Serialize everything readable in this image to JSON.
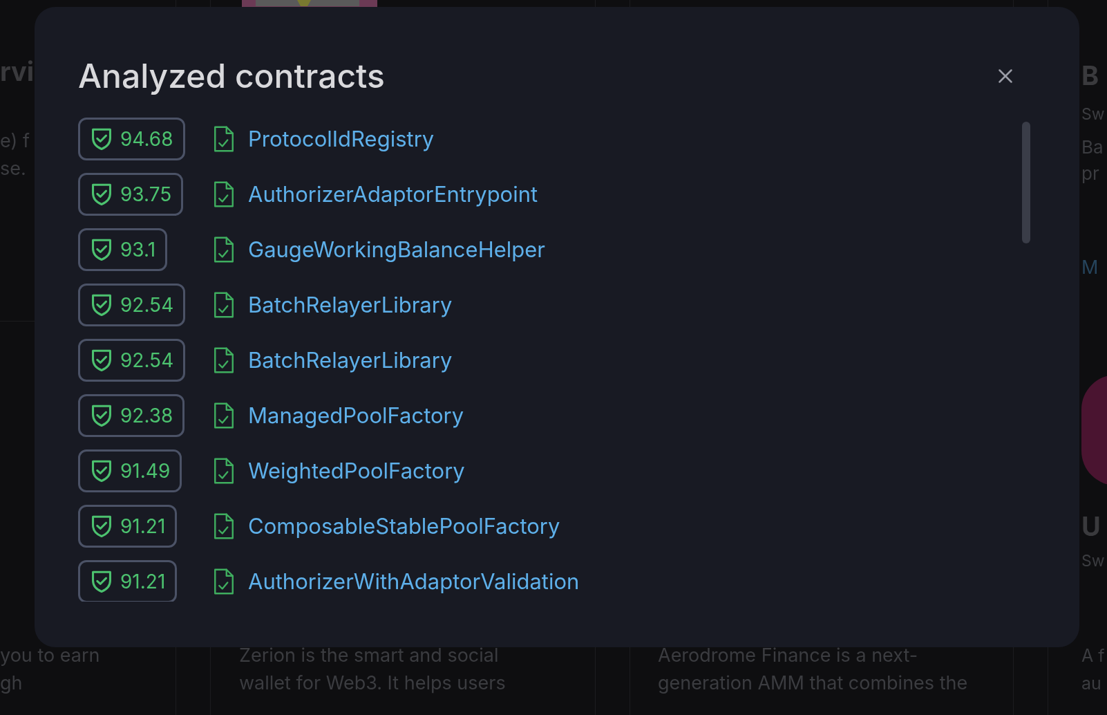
{
  "background": {
    "cards": [
      {
        "title": "rvi",
        "lines": [
          "e) f",
          "se."
        ],
        "bottom_lines": [
          "you to earn",
          "gh"
        ]
      },
      {
        "bottom_lines": [
          "Zerion is the smart and social",
          "wallet for Web3. It helps users"
        ]
      },
      {
        "bottom_lines": [
          "Aerodrome Finance is a next-",
          "generation AMM that combines the"
        ]
      },
      {
        "title": "B",
        "subtitle": "Sw",
        "lines": [
          "Ba",
          "pr"
        ],
        "link": "M",
        "title2": "U",
        "subtitle2": "Sw",
        "bottom_lines": [
          "A f",
          "au"
        ]
      }
    ]
  },
  "dialog": {
    "title": "Analyzed contracts",
    "contracts": [
      {
        "score": "94.68",
        "name": "ProtocolIdRegistry"
      },
      {
        "score": "93.75",
        "name": "AuthorizerAdaptorEntrypoint"
      },
      {
        "score": "93.1",
        "name": "GaugeWorkingBalanceHelper"
      },
      {
        "score": "92.54",
        "name": "BatchRelayerLibrary"
      },
      {
        "score": "92.54",
        "name": "BatchRelayerLibrary"
      },
      {
        "score": "92.38",
        "name": "ManagedPoolFactory"
      },
      {
        "score": "91.49",
        "name": "WeightedPoolFactory"
      },
      {
        "score": "91.21",
        "name": "ComposableStablePoolFactory"
      },
      {
        "score": "91.21",
        "name": "AuthorizerWithAdaptorValidation"
      }
    ]
  }
}
